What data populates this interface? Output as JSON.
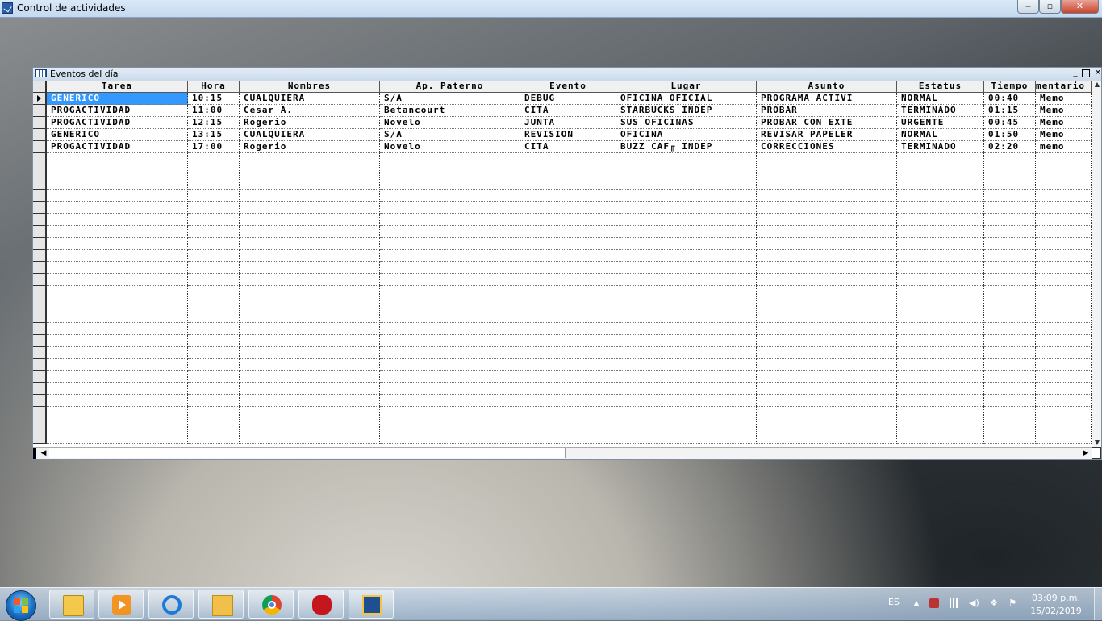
{
  "app": {
    "title": "Control de actividades",
    "min_label": "‒",
    "max_label": "▫",
    "close_label": "✕"
  },
  "child": {
    "title": "Eventos del día",
    "min_label": "_",
    "max_label": "",
    "close_label": "✕"
  },
  "grid": {
    "columns": [
      "Tarea",
      "Hora",
      "Nombres",
      "Ap. Paterno",
      "Evento",
      "Lugar",
      "Asunto",
      "Estatus",
      "Tiempo",
      "mentario"
    ],
    "rows": [
      [
        "GENERICO",
        "10:15",
        "CUALQUIERA",
        "S/A",
        "DEBUG",
        "OFICINA OFICIAL",
        "PROGRAMA ACTIVI",
        "NORMAL",
        "00:40",
        "Memo"
      ],
      [
        "PROGACTIVIDAD",
        "11:00",
        "Cesar A.",
        "Betancourt",
        "CITA",
        "STARBUCKS INDEP",
        "PROBAR",
        "TERMINADO",
        "01:15",
        "Memo"
      ],
      [
        "PROGACTIVIDAD",
        "12:15",
        "Rogerio",
        "Novelo",
        "JUNTA",
        "SUS OFICINAS",
        "PROBAR CON EXTE",
        "URGENTE",
        "00:45",
        "Memo"
      ],
      [
        "GENERICO",
        "13:15",
        "CUALQUIERA",
        "S/A",
        "REVISION",
        "OFICINA",
        "REVISAR PAPELER",
        "NORMAL",
        "01:50",
        "Memo"
      ],
      [
        "PROGACTIVIDAD",
        "17:00",
        "Rogerio",
        "Novelo",
        "CITA",
        "BUZZ CAF╓ INDEP",
        "CORRECCIONES",
        "TERMINADO",
        "02:20",
        "memo"
      ]
    ],
    "empty_row_count": 24,
    "selected_cell": {
      "row": 0,
      "col": 0
    },
    "selection_color": "#3399ff"
  },
  "scroll": {
    "up": "▲",
    "down": "▼",
    "left": "◀",
    "right": "▶"
  },
  "taskbar": {
    "apps": [
      "file-explorer",
      "media-player",
      "internet-explorer",
      "outlook",
      "chrome",
      "bug-app",
      "control-actividades"
    ],
    "language": "ES",
    "tray_show_hidden": "▲",
    "time": "03:09 p.m.",
    "date": "15/02/2019"
  }
}
